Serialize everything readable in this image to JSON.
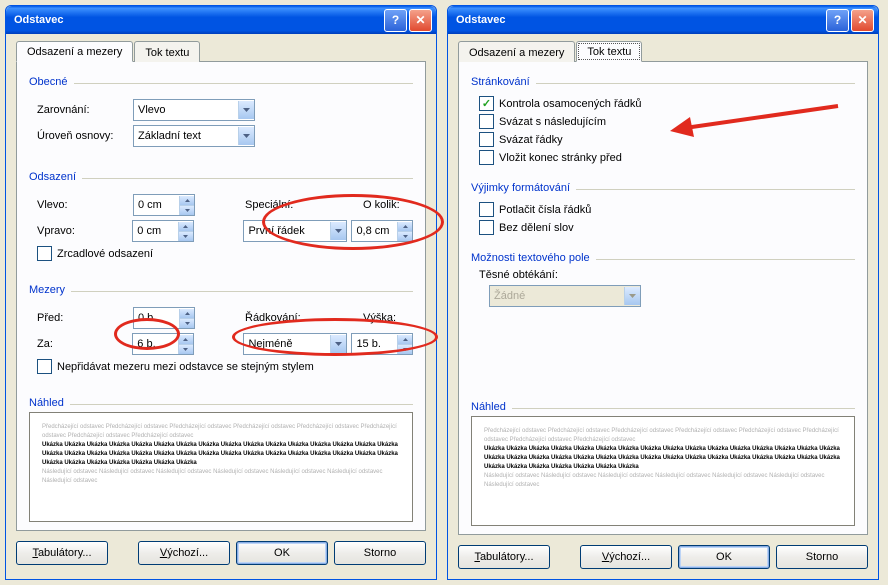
{
  "dialogTitle": "Odstavec",
  "tabs": {
    "indent": "Odsazení a mezery",
    "flow": "Tok textu"
  },
  "general": {
    "group": "Obecné",
    "alignLabel": "Zarovnání:",
    "alignValue": "Vlevo",
    "levelLabel": "Úroveň osnovy:",
    "levelValue": "Základní text"
  },
  "indent": {
    "group": "Odsazení",
    "leftLabel": "Vlevo:",
    "leftValue": "0 cm",
    "rightLabel": "Vpravo:",
    "rightValue": "0 cm",
    "specialLabel": "Speciální:",
    "specialValue": "První řádek",
    "byLabel": "O kolik:",
    "byValue": "0,8 cm",
    "mirror": "Zrcadlové odsazení"
  },
  "spacing": {
    "group": "Mezery",
    "beforeLabel": "Před:",
    "beforeValue": "0 b.",
    "afterLabel": "Za:",
    "afterValue": "6 b.",
    "lineLabel": "Řádkování:",
    "lineValue": "Nejméně",
    "heightLabel": "Výška:",
    "heightValue": "15 b.",
    "noAdd": "Nepřidávat mezeru mezi odstavce se stejným stylem"
  },
  "previewLabel": "Náhled",
  "previewText1": "Předcházející odstavec Předcházející odstavec Předcházející odstavec Předcházející odstavec Předcházející odstavec Předcházející odstavec Předcházející odstavec Předcházející odstavec",
  "previewText2": "Ukázka Ukázka Ukázka Ukázka Ukázka Ukázka Ukázka Ukázka Ukázka Ukázka Ukázka Ukázka Ukázka Ukázka Ukázka Ukázka Ukázka Ukázka Ukázka Ukázka Ukázka Ukázka Ukázka Ukázka Ukázka Ukázka Ukázka Ukázka Ukázka Ukázka Ukázka Ukázka Ukázka Ukázka Ukázka Ukázka Ukázka Ukázka Ukázka",
  "previewText3": "Následující odstavec Následující odstavec Následující odstavec Následující odstavec Následující odstavec Následující odstavec Následující odstavec",
  "buttons": {
    "tabs": "Tabulátory...",
    "default": "Výchozí...",
    "ok": "OK",
    "cancel": "Storno"
  },
  "page": {
    "group": "Stránkování",
    "widow": "Kontrola osamocených řádků",
    "keepNext": "Svázat s následujícím",
    "keepLines": "Svázat řádky",
    "pageBreak": "Vložit konec stránky před"
  },
  "except": {
    "group": "Výjimky formátování",
    "suppress": "Potlačit čísla řádků",
    "noHyphen": "Bez dělení slov"
  },
  "textbox": {
    "group": "Možnosti textového pole",
    "wrapLabel": "Těsné obtékání:",
    "wrapValue": "Žádné"
  }
}
